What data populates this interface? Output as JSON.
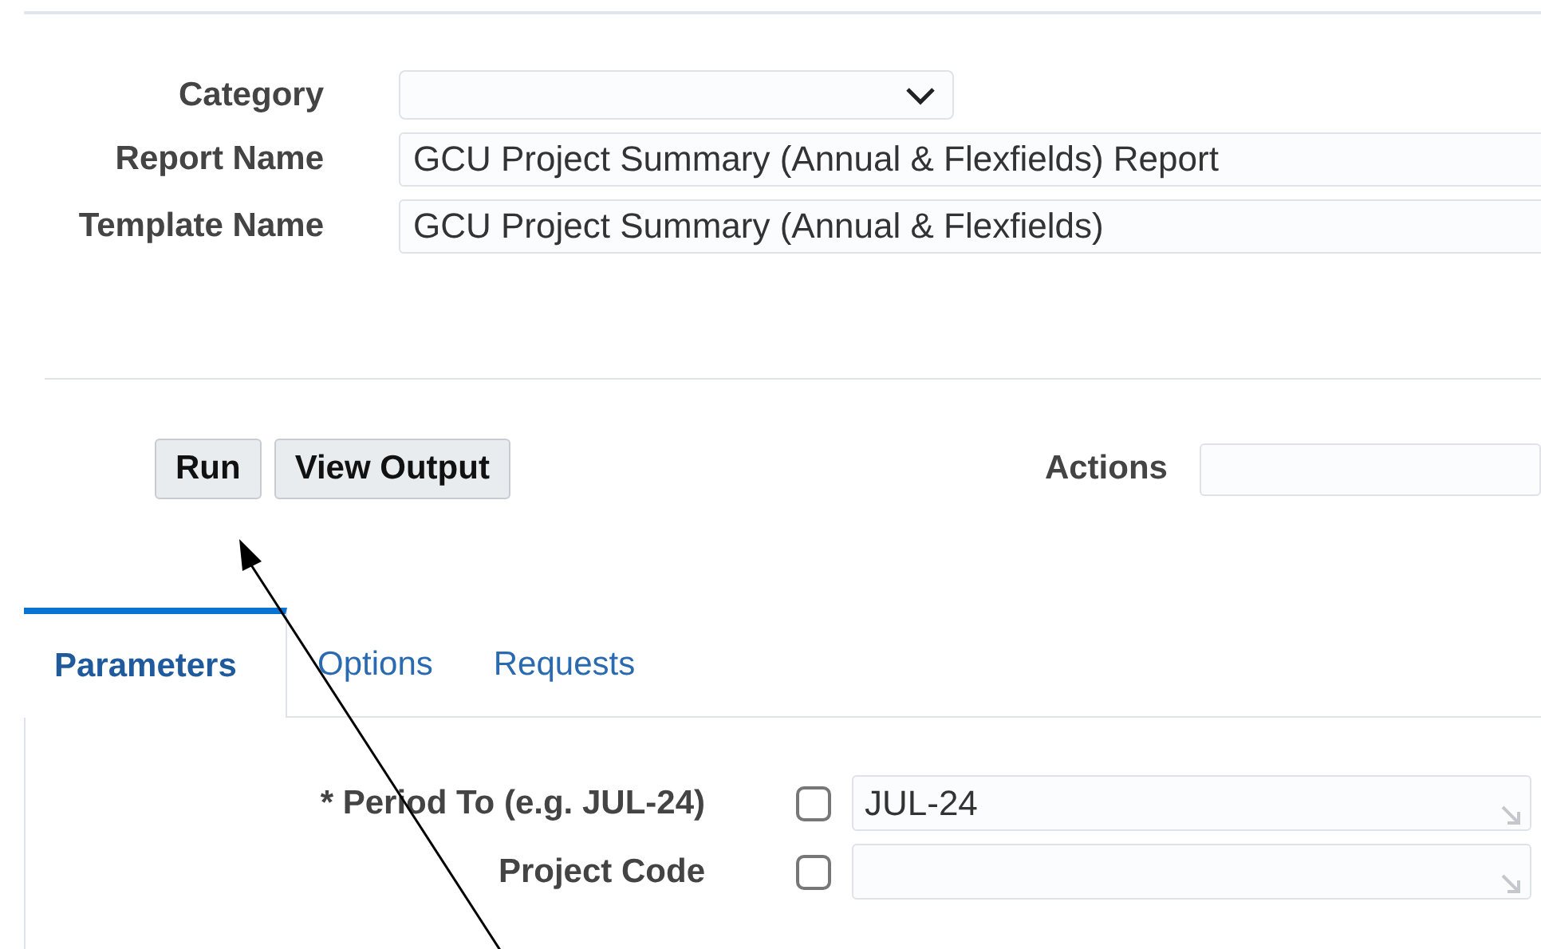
{
  "form": {
    "fields": [
      {
        "label": "Category",
        "kind": "select"
      },
      {
        "label": "Report Name",
        "kind": "text",
        "value": "GCU Project Summary (Annual & Flexfields) Report"
      },
      {
        "label": "Template Name",
        "kind": "text",
        "value": "GCU Project Summary (Annual & Flexfields)"
      }
    ]
  },
  "buttons": [
    "Run",
    "View Output"
  ],
  "actions": {
    "label": "Actions"
  },
  "tabs": [
    {
      "label": "Parameters",
      "selected": true
    },
    {
      "label": "Options",
      "selected": false
    },
    {
      "label": "Requests",
      "selected": false
    }
  ],
  "parameters": [
    {
      "label": "* Period To (e.g. JUL-24)",
      "checked": false,
      "value": "JUL-24"
    },
    {
      "label": "Project Code",
      "checked": false
    }
  ]
}
